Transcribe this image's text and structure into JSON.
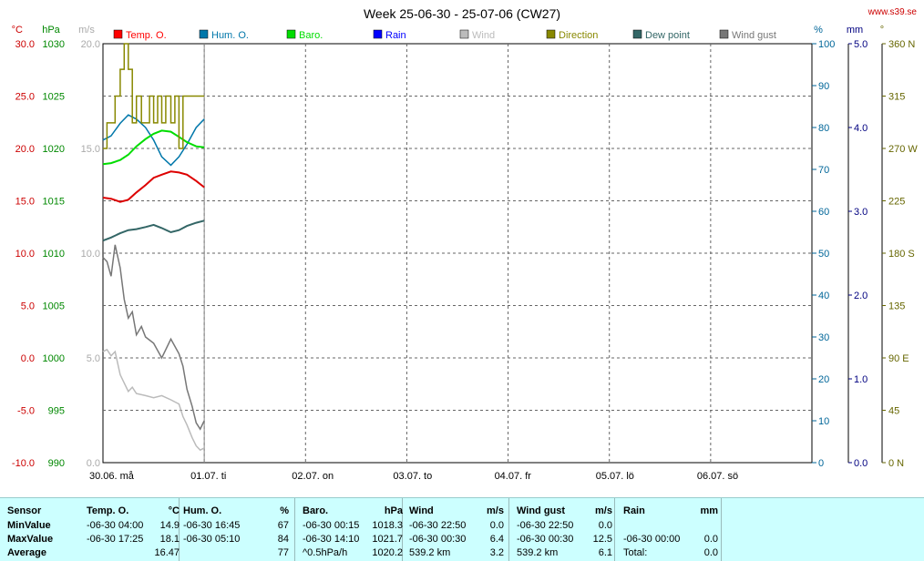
{
  "title": "Week 25-06-30 - 25-07-06 (CW27)",
  "site": "www.s39.se",
  "chart_data": {
    "type": "line",
    "x_range": [
      0,
      7
    ],
    "x_ticks": [
      {
        "x": 0,
        "label": "30.06.  må"
      },
      {
        "x": 1,
        "label": "01.07.  ti"
      },
      {
        "x": 2,
        "label": "02.07.  on"
      },
      {
        "x": 3,
        "label": "03.07.  to"
      },
      {
        "x": 4,
        "label": "04.07.  fr"
      },
      {
        "x": 5,
        "label": "05.07.  lö"
      },
      {
        "x": 6,
        "label": "06.07.  sö"
      }
    ],
    "axes": {
      "temp": {
        "unit": "°C",
        "min": -10,
        "max": 30,
        "ticks": [
          "30.0",
          "25.0",
          "20.0",
          "15.0",
          "10.0",
          "5.0",
          "0.0",
          "-5.0",
          "-10.0"
        ],
        "color": "#cc0000"
      },
      "baro": {
        "unit": "hPa",
        "min": 990,
        "max": 1030,
        "ticks": [
          "1030",
          "1025",
          "1020",
          "1015",
          "1010",
          "1005",
          "1000",
          "995",
          "990"
        ],
        "color": "#008800"
      },
      "wind": {
        "unit": "m/s",
        "min": 0,
        "max": 20,
        "ticks": [
          "20.0",
          "",
          "15.0",
          "",
          "10.0",
          "",
          "5.0",
          "",
          "0.0"
        ],
        "color": "#aaaaaa"
      },
      "hum": {
        "unit": "%",
        "min": 0,
        "max": 100,
        "ticks": [
          "100",
          "90",
          "80",
          "70",
          "60",
          "50",
          "40",
          "30",
          "20",
          "10",
          "0"
        ],
        "color": "#006699"
      },
      "rain": {
        "unit": "mm",
        "min": 0,
        "max": 5,
        "ticks": [
          "5.0",
          "4.0",
          "3.0",
          "2.0",
          "1.0",
          "0.0"
        ],
        "color": "#000080"
      },
      "dir": {
        "unit": "°",
        "min": 0,
        "max": 360,
        "ticks": [
          "360 N",
          "315",
          "270 W",
          "225",
          "180 S",
          "135",
          "90  E",
          "45",
          "0   N"
        ],
        "color": "#666600"
      }
    },
    "legend": [
      {
        "name": "Temp. O.",
        "color": "#ff0000"
      },
      {
        "name": "Hum. O.",
        "color": "#0077aa"
      },
      {
        "name": "Baro.",
        "color": "#00dd00"
      },
      {
        "name": "Rain",
        "color": "#0000ff"
      },
      {
        "name": "Wind",
        "color": "#bbbbbb"
      },
      {
        "name": "Direction",
        "color": "#888800"
      },
      {
        "name": "Dew point",
        "color": "#336666"
      },
      {
        "name": "Wind gust",
        "color": "#777777"
      }
    ],
    "series": [
      {
        "name": "Temp. O.",
        "axis": "temp",
        "color": "#dd0000",
        "x": [
          0,
          0.08,
          0.17,
          0.25,
          0.33,
          0.42,
          0.5,
          0.58,
          0.67,
          0.75,
          0.83,
          0.92,
          1.0
        ],
        "y": [
          15.3,
          15.2,
          14.9,
          15.1,
          15.8,
          16.5,
          17.2,
          17.5,
          17.8,
          17.7,
          17.5,
          16.9,
          16.3
        ]
      },
      {
        "name": "Hum. O.",
        "axis": "hum",
        "color": "#0077aa",
        "x": [
          0,
          0.08,
          0.17,
          0.25,
          0.33,
          0.42,
          0.5,
          0.58,
          0.67,
          0.75,
          0.83,
          0.92,
          1.0
        ],
        "y": [
          77,
          78,
          81,
          83,
          82,
          80,
          77,
          73,
          71,
          73,
          76,
          80,
          82
        ]
      },
      {
        "name": "Baro.",
        "axis": "baro",
        "color": "#00dd00",
        "x": [
          0,
          0.08,
          0.17,
          0.25,
          0.33,
          0.42,
          0.5,
          0.58,
          0.67,
          0.75,
          0.83,
          0.92,
          1.0
        ],
        "y": [
          1018.5,
          1018.6,
          1018.9,
          1019.4,
          1020.2,
          1020.9,
          1021.4,
          1021.7,
          1021.6,
          1021.1,
          1020.6,
          1020.2,
          1020.1
        ]
      },
      {
        "name": "Dew point",
        "axis": "temp",
        "color": "#336666",
        "x": [
          0,
          0.08,
          0.17,
          0.25,
          0.33,
          0.42,
          0.5,
          0.58,
          0.67,
          0.75,
          0.83,
          0.92,
          1.0
        ],
        "y": [
          11.2,
          11.5,
          11.9,
          12.2,
          12.3,
          12.5,
          12.7,
          12.4,
          12.0,
          12.2,
          12.6,
          12.9,
          13.1
        ]
      },
      {
        "name": "Wind gust",
        "axis": "wind",
        "color": "#777777",
        "x": [
          0,
          0.04,
          0.08,
          0.12,
          0.17,
          0.21,
          0.25,
          0.29,
          0.33,
          0.38,
          0.42,
          0.5,
          0.58,
          0.67,
          0.75,
          0.79,
          0.83,
          0.88,
          0.92,
          0.96,
          1.0
        ],
        "y": [
          9.8,
          9.6,
          8.9,
          10.4,
          9.3,
          7.8,
          6.9,
          7.2,
          6.1,
          6.5,
          6.0,
          5.7,
          5.0,
          5.9,
          5.2,
          4.6,
          3.5,
          2.7,
          1.9,
          1.6,
          2.0
        ]
      },
      {
        "name": "Wind",
        "axis": "wind",
        "color": "#bbbbbb",
        "x": [
          0,
          0.04,
          0.08,
          0.12,
          0.17,
          0.21,
          0.25,
          0.29,
          0.33,
          0.42,
          0.5,
          0.58,
          0.67,
          0.75,
          0.79,
          0.83,
          0.88,
          0.92,
          0.96,
          1.0
        ],
        "y": [
          5.3,
          5.4,
          5.1,
          5.3,
          4.2,
          3.8,
          3.4,
          3.6,
          3.3,
          3.2,
          3.1,
          3.2,
          3.0,
          2.8,
          2.2,
          1.8,
          1.2,
          0.8,
          0.6,
          0.7
        ]
      },
      {
        "name": "Direction",
        "axis": "dir",
        "color": "#888800",
        "step": true,
        "x": [
          0,
          0.04,
          0.08,
          0.12,
          0.17,
          0.21,
          0.25,
          0.29,
          0.33,
          0.38,
          0.42,
          0.46,
          0.5,
          0.54,
          0.58,
          0.62,
          0.67,
          0.71,
          0.75,
          0.79,
          0.83,
          0.88,
          0.92,
          0.96,
          1.0
        ],
        "y": [
          270,
          292,
          292,
          315,
          338,
          360,
          338,
          292,
          315,
          292,
          292,
          315,
          292,
          315,
          292,
          315,
          292,
          315,
          270,
          315,
          315,
          315,
          315,
          315,
          315
        ]
      }
    ]
  },
  "stats": {
    "headers": [
      {
        "label": "Sensor",
        "unit": ""
      },
      {
        "label": "Temp. O.",
        "unit": "°C"
      },
      {
        "label": "Hum. O.",
        "unit": "%"
      },
      {
        "label": "Baro.",
        "unit": "hPa"
      },
      {
        "label": "Wind",
        "unit": "m/s"
      },
      {
        "label": "Wind gust",
        "unit": "m/s"
      },
      {
        "label": "Rain",
        "unit": "mm"
      }
    ],
    "rows": [
      {
        "label": "MinValue",
        "cells": [
          {
            "time": "-06-30  04:00",
            "value": "14.9"
          },
          {
            "time": "-06-30  16:45",
            "value": "67"
          },
          {
            "time": "-06-30  00:15",
            "value": "1018.3"
          },
          {
            "time": "-06-30  22:50",
            "value": "0.0"
          },
          {
            "time": "-06-30  22:50",
            "value": "0.0"
          },
          {
            "time": "",
            "value": ""
          }
        ]
      },
      {
        "label": "MaxValue",
        "cells": [
          {
            "time": "-06-30  17:25",
            "value": "18.1"
          },
          {
            "time": "-06-30  05:10",
            "value": "84"
          },
          {
            "time": "-06-30  14:10",
            "value": "1021.7"
          },
          {
            "time": "-06-30  00:30",
            "value": "6.4"
          },
          {
            "time": "-06-30  00:30",
            "value": "12.5"
          },
          {
            "time": "-06-30  00:00",
            "value": "0.0"
          }
        ]
      },
      {
        "label": "Average",
        "cells": [
          {
            "time": "",
            "value": "16.47"
          },
          {
            "time": "",
            "value": "77"
          },
          {
            "time": "^0.5hPa/h",
            "value": "1020.2"
          },
          {
            "time": "539.2 km",
            "value": "3.2"
          },
          {
            "time": "539.2 km",
            "value": "6.1"
          },
          {
            "time": "Total:",
            "value": "0.0"
          }
        ]
      }
    ]
  }
}
